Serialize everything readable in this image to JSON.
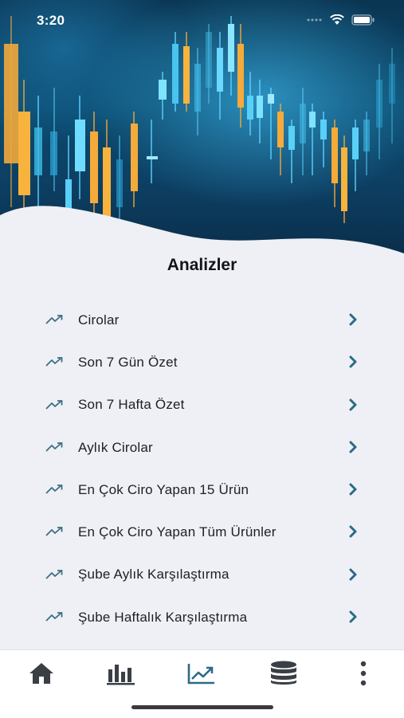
{
  "status_bar": {
    "time": "3:20"
  },
  "page": {
    "title": "Analizler"
  },
  "menu": {
    "items": [
      {
        "label": "Cirolar",
        "icon": "trending-up-icon"
      },
      {
        "label": "Son 7 Gün Özet",
        "icon": "trending-up-icon"
      },
      {
        "label": "Son 7 Hafta Özet",
        "icon": "trending-up-icon"
      },
      {
        "label": "Aylık Cirolar",
        "icon": "trending-up-icon"
      },
      {
        "label": "En Çok Ciro Yapan 15 Ürün",
        "icon": "trending-up-icon"
      },
      {
        "label": "En Çok Ciro Yapan Tüm Ürünler",
        "icon": "trending-up-icon"
      },
      {
        "label": "Şube Aylık Karşılaştırma",
        "icon": "trending-up-icon"
      },
      {
        "label": "Şube Haftalık Karşılaştırma",
        "icon": "trending-up-icon"
      }
    ]
  },
  "tab_bar": {
    "tabs": [
      {
        "icon": "home-icon",
        "active": false
      },
      {
        "icon": "bar-chart-icon",
        "active": false
      },
      {
        "icon": "trending-up-icon",
        "active": true
      },
      {
        "icon": "database-icon",
        "active": false
      },
      {
        "icon": "more-vertical-icon",
        "active": false
      }
    ]
  },
  "colors": {
    "accent": "#2d6a86",
    "icon_muted": "#3f6e85",
    "tab_icon": "#3a3f46",
    "background": "#eef0f5"
  }
}
